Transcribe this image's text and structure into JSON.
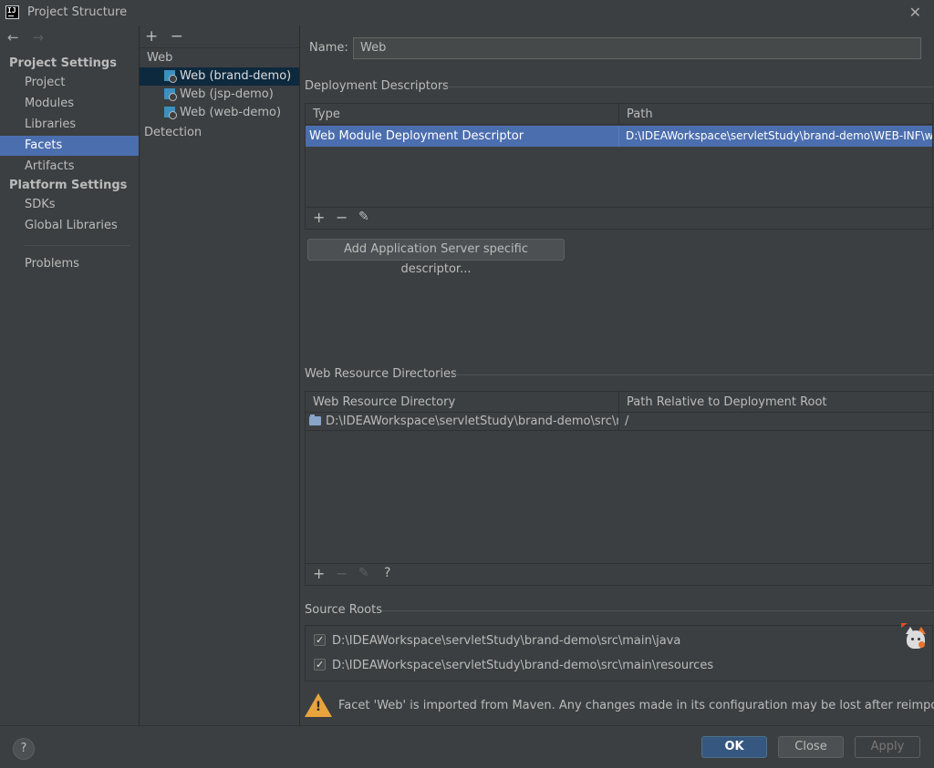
{
  "window": {
    "title": "Project Structure",
    "close_glyph": "✕"
  },
  "nav": {
    "back_glyph": "←",
    "forward_glyph": "→",
    "project_settings_header": "Project Settings",
    "project_items": [
      "Project",
      "Modules",
      "Libraries",
      "Facets",
      "Artifacts"
    ],
    "selected_item": "Facets",
    "platform_settings_header": "Platform Settings",
    "platform_items": [
      "SDKs",
      "Global Libraries"
    ],
    "problems": "Problems"
  },
  "facets": {
    "add_glyph": "+",
    "remove_glyph": "−",
    "group": "Web",
    "items": [
      "Web (brand-demo)",
      "Web (jsp-demo)",
      "Web (web-demo)"
    ],
    "selected_item": "Web (brand-demo)",
    "detection": "Detection"
  },
  "detail": {
    "name_label": "Name:",
    "name_value": "Web",
    "deployment": {
      "title": "Deployment Descriptors",
      "columns": [
        "Type",
        "Path"
      ],
      "rows": [
        {
          "type": "Web Module Deployment Descriptor",
          "path": "D:\\IDEAWorkspace\\servletStudy\\brand-demo\\WEB-INF\\w"
        }
      ],
      "toolbar": {
        "add": "+",
        "remove": "−",
        "edit": "✎"
      },
      "add_server_button": "Add Application Server specific descriptor..."
    },
    "resources": {
      "title": "Web Resource Directories",
      "columns": [
        "Web Resource Directory",
        "Path Relative to Deployment Root"
      ],
      "rows": [
        {
          "directory": "D:\\IDEAWorkspace\\servletStudy\\brand-demo\\src\\m...",
          "relative": "/"
        }
      ],
      "toolbar": {
        "add": "+",
        "remove": "−",
        "edit": "✎",
        "help": "?"
      }
    },
    "source_roots": {
      "title": "Source Roots",
      "items": [
        {
          "path": "D:\\IDEAWorkspace\\servletStudy\\brand-demo\\src\\main\\java",
          "checked": true
        },
        {
          "path": "D:\\IDEAWorkspace\\servletStudy\\brand-demo\\src\\main\\resources",
          "checked": true
        }
      ]
    },
    "warning": {
      "bang": "!",
      "text": "Facet 'Web' is imported from Maven. Any changes made in its configuration may be lost after reimporting."
    }
  },
  "footer": {
    "help": "?",
    "ok": "OK",
    "close": "Close",
    "apply": "Apply"
  },
  "colors": {
    "background": "#3c3f41",
    "selection": "#4b6eaf",
    "tree_selection": "#0d293e",
    "primary_button": "#365880",
    "warning": "#e8a33d"
  }
}
